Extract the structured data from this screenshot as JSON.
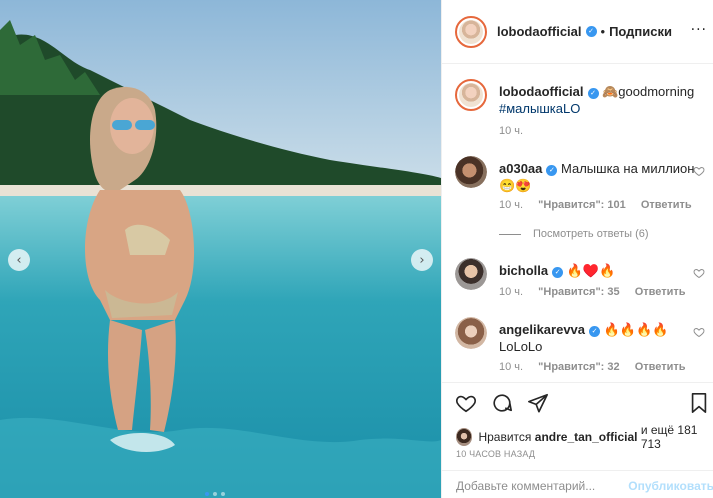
{
  "colors": {
    "accent": "#3897f0",
    "muted": "#8e8e8e",
    "text": "#262626",
    "hashtag": "#00376b",
    "publish_disabled": "#b2dffc"
  },
  "post_image": {
    "carousel_prev_icon": "chevron-left-icon",
    "carousel_next_icon": "chevron-right-icon"
  },
  "header": {
    "username": "lobodaofficial",
    "separator": "•",
    "follow_label": "Подписки",
    "more_icon": "more-icon",
    "more_glyph": "···"
  },
  "caption": {
    "username": "lobodaofficial",
    "text": "🙈goodmorning",
    "hashtag": "#малышкаLO",
    "time": "10 ч."
  },
  "comments": [
    {
      "username": "a030aa",
      "text": "Малышка на миллион",
      "text2": "😁😍",
      "time": "10 ч.",
      "likes": "\"Нравится\": 101",
      "reply": "Ответить",
      "view_replies": "Посмотреть ответы (6)"
    },
    {
      "username": "bicholla",
      "text": "🔥♥️🔥",
      "time": "10 ч.",
      "likes": "\"Нравится\": 35",
      "reply": "Ответить"
    },
    {
      "username": "angelikarevva",
      "text": "🔥🔥🔥🔥",
      "text2": "LoLoLo",
      "time": "10 ч.",
      "likes": "\"Нравится\": 32",
      "reply": "Ответить"
    }
  ],
  "likes": {
    "prefix": "Нравится",
    "user": "andre_tan_official",
    "suffix": "и ещё 181 713"
  },
  "time_ago": "10 ЧАСОВ НАЗАД",
  "add_comment": {
    "placeholder": "Добавьте комментарий...",
    "publish_label": "Опубликовать"
  }
}
